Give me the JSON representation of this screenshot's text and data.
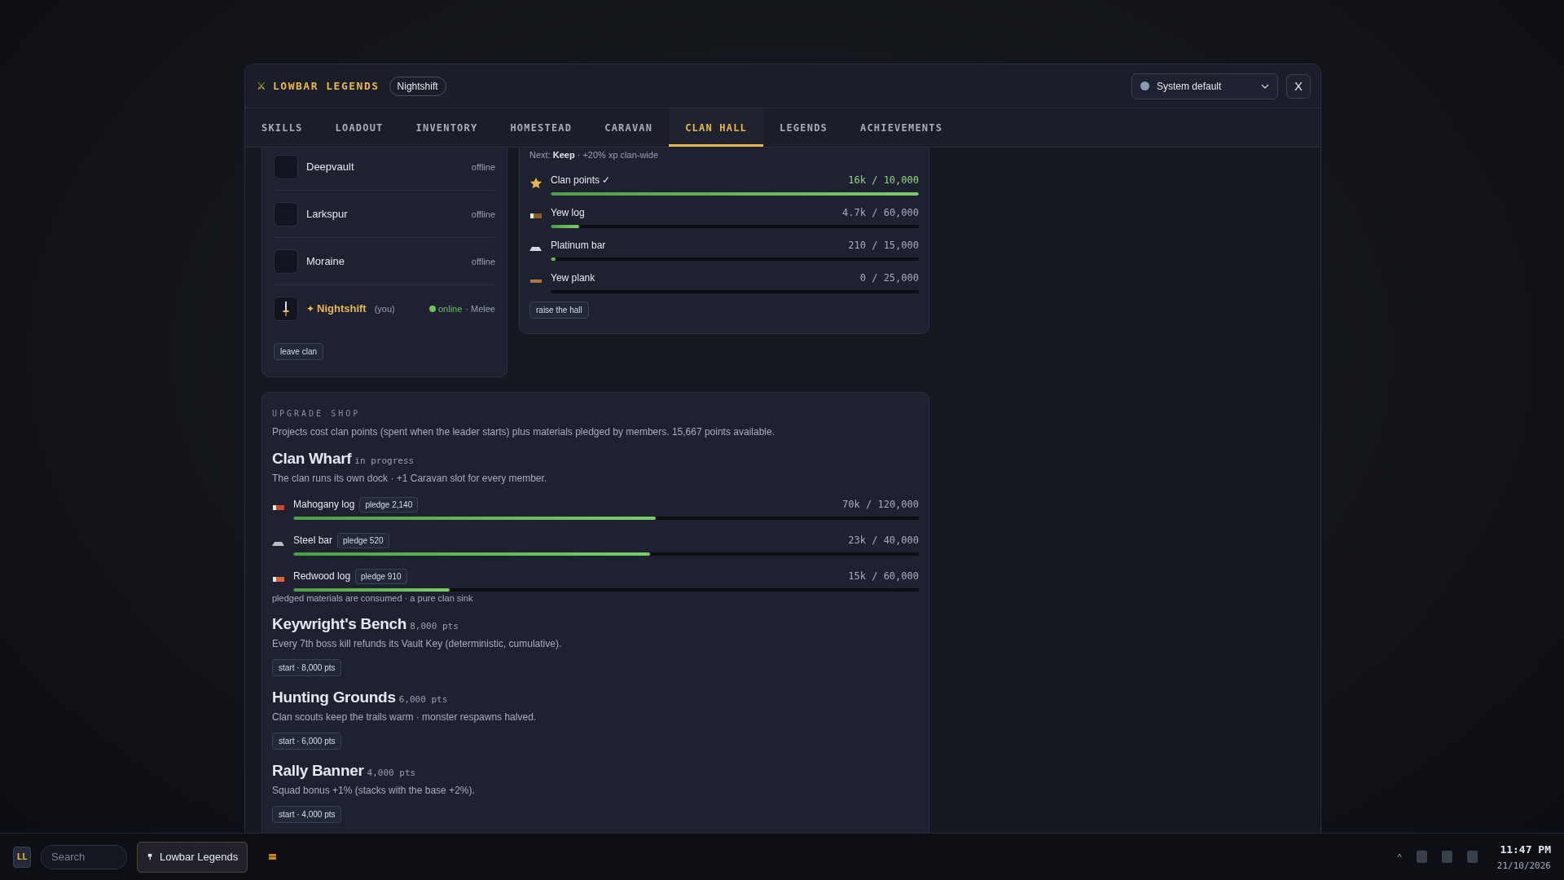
{
  "window": {
    "icon": "⚔",
    "title": "LOWBAR LEGENDS",
    "badge": "Nightshift",
    "theme_select": {
      "value": "System default"
    },
    "close": "X"
  },
  "tabs": [
    {
      "label": "SKILLS",
      "selected": false
    },
    {
      "label": "LOADOUT",
      "selected": false
    },
    {
      "label": "INVENTORY",
      "selected": false
    },
    {
      "label": "HOMESTEAD",
      "selected": false
    },
    {
      "label": "CARAVAN",
      "selected": false
    },
    {
      "label": "CLAN HALL",
      "selected": true
    },
    {
      "label": "LEGENDS",
      "selected": false
    },
    {
      "label": "ACHIEVEMENTS",
      "selected": false
    }
  ],
  "members": {
    "items": [
      {
        "kind": "member",
        "name": "Deepvault",
        "status": "offline",
        "online": false
      },
      {
        "kind": "member",
        "name": "Larkspur",
        "status": "offline",
        "online": false
      },
      {
        "kind": "member",
        "name": "Moraine",
        "status": "offline",
        "online": false
      },
      {
        "kind": "self",
        "star": "✦",
        "name": "Nightshift",
        "you": "(you)",
        "status": "online",
        "role": "· Melee",
        "online": true
      }
    ],
    "leave_button": "leave clan"
  },
  "hall": {
    "next_label": "Next:",
    "next_value": "Keep",
    "next_note": "· +20% xp clan-wide",
    "requirements": [
      {
        "kind": "star",
        "color": "#e8b84a",
        "name": "Clan points ✓",
        "met": true,
        "reading": "16k / 10,000",
        "level": 1
      },
      {
        "kind": "log",
        "color": "#8a5a2b",
        "name": "Yew log",
        "met": false,
        "reading": "4.7k / 60,000",
        "level": 0.078
      },
      {
        "kind": "bar",
        "color": "#d4d8e0",
        "name": "Platinum bar",
        "met": false,
        "reading": "210 / 15,000",
        "level": 0.014
      },
      {
        "kind": "plank",
        "color": "#b07a3a",
        "name": "Yew plank",
        "met": false,
        "reading": "0 / 25,000",
        "level": 0
      }
    ],
    "button": "raise the hall"
  },
  "shop": {
    "heading": "UPGRADE SHOP",
    "intro": "Projects cost clan points (spent when the leader starts) plus materials pledged by members. 15,667 points available.",
    "projects": [
      {
        "kind": "active",
        "name": "Clan Wharf",
        "tag": "in progress",
        "desc": "The clan runs its own dock · +1 Caravan slot for every member.",
        "materials": [
          {
            "kind": "log",
            "color": "#c8463c",
            "name": "Mahogany log",
            "pledge": "pledge 2,140",
            "reading": "70k / 120,000",
            "level": 0.58
          },
          {
            "kind": "bar",
            "color": "#b8bcc6",
            "name": "Steel bar",
            "pledge": "pledge 520",
            "reading": "23k / 40,000",
            "level": 0.57
          },
          {
            "kind": "log",
            "color": "#d8603e",
            "name": "Redwood log",
            "pledge": "pledge 910",
            "reading": "15k / 60,000",
            "level": 0.25
          }
        ],
        "note": "pledged materials are consumed · a pure clan sink"
      },
      {
        "kind": "available",
        "name": "Keywright's Bench",
        "tag": "8,000 pts",
        "desc": "Every 7th boss kill refunds its Vault Key (deterministic, cumulative).",
        "button": "start · 8,000 pts"
      },
      {
        "kind": "available",
        "name": "Hunting Grounds",
        "tag": "6,000 pts",
        "desc": "Clan scouts keep the trails warm · monster respawns halved.",
        "button": "start · 6,000 pts"
      },
      {
        "kind": "available",
        "name": "Rally Banner",
        "tag": "4,000 pts",
        "desc": "Squad bonus +1% (stacks with the base +2%).",
        "button": "start · 4,000 pts"
      }
    ]
  },
  "taskbar": {
    "logo": "LL",
    "search": {
      "placeholder": "Search"
    },
    "app": "Lowbar Legends",
    "tray_caret": "^",
    "time": "11:47 PM",
    "date": "21/10/2026"
  }
}
